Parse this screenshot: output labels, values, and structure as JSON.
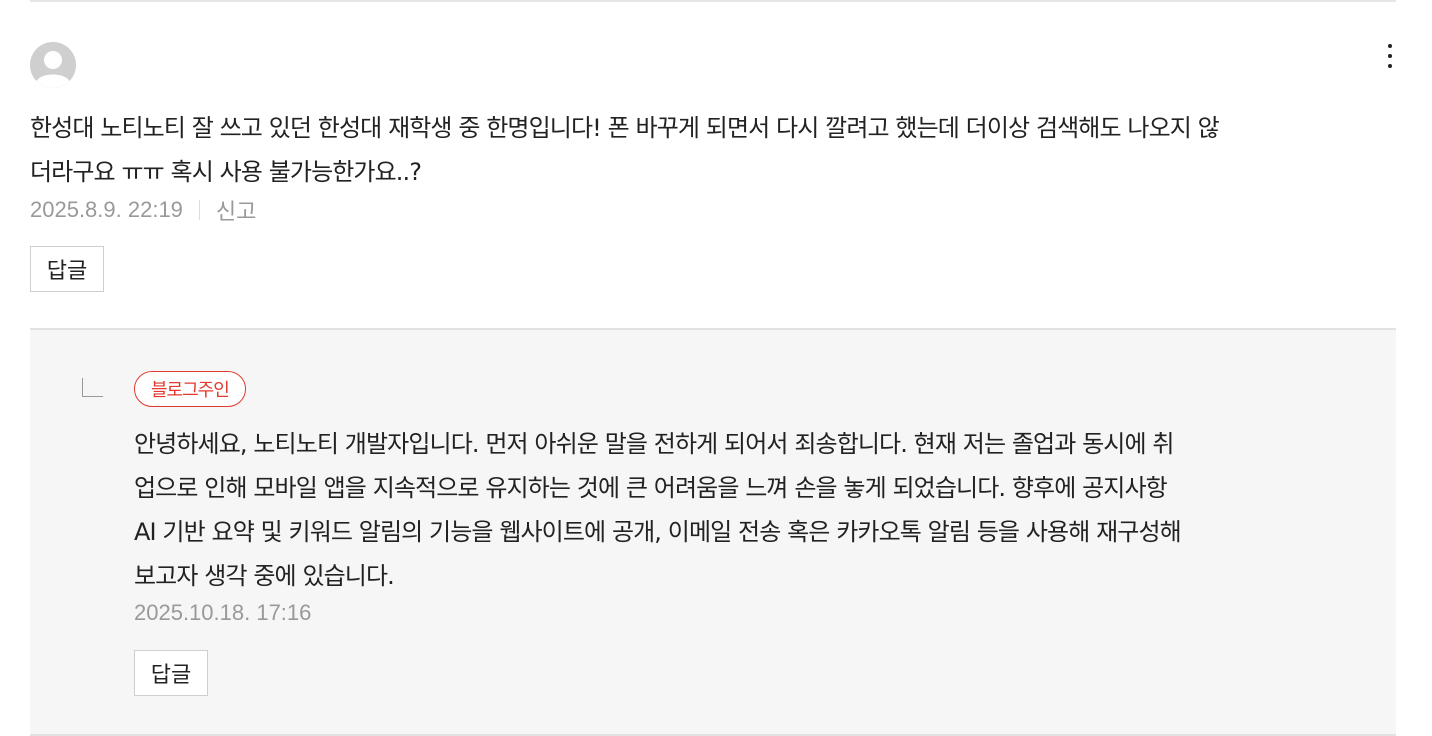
{
  "comment": {
    "text": "한성대 노티노티 잘 쓰고 있던 한성대 재학생 중 한명입니다! 폰 바꾸게 되면서 다시 깔려고 했는데 더이상 검색해도 나오지 않\n더라구요 ㅠㅠ 혹시 사용 불가능한가요..?",
    "timestamp": "2025.8.9. 22:19",
    "report_label": "신고",
    "reply_label": "답글",
    "avatar_icon": "default-user-icon",
    "menu_icon": "more-vertical-icon"
  },
  "reply": {
    "badge": "블로그주인",
    "badge_color": "#e23a2e",
    "text": "안녕하세요, 노티노티 개발자입니다. 먼저 아쉬운 말을 전하게 되어서 죄송합니다. 현재 저는 졸업과 동시에 취\n업으로 인해 모바일 앱을 지속적으로 유지하는 것에 큰 어려움을 느껴 손을 놓게 되었습니다. 향후에 공지사항\nAI 기반 요약 및 키워드 알림의 기능을 웹사이트에 공개, 이메일 전송 혹은 카카오톡 알림 등을 사용해 재구성해\n보고자 생각 중에 있습니다.",
    "timestamp": "2025.10.18. 17:16",
    "reply_label": "답글",
    "background": "#f6f6f6"
  }
}
